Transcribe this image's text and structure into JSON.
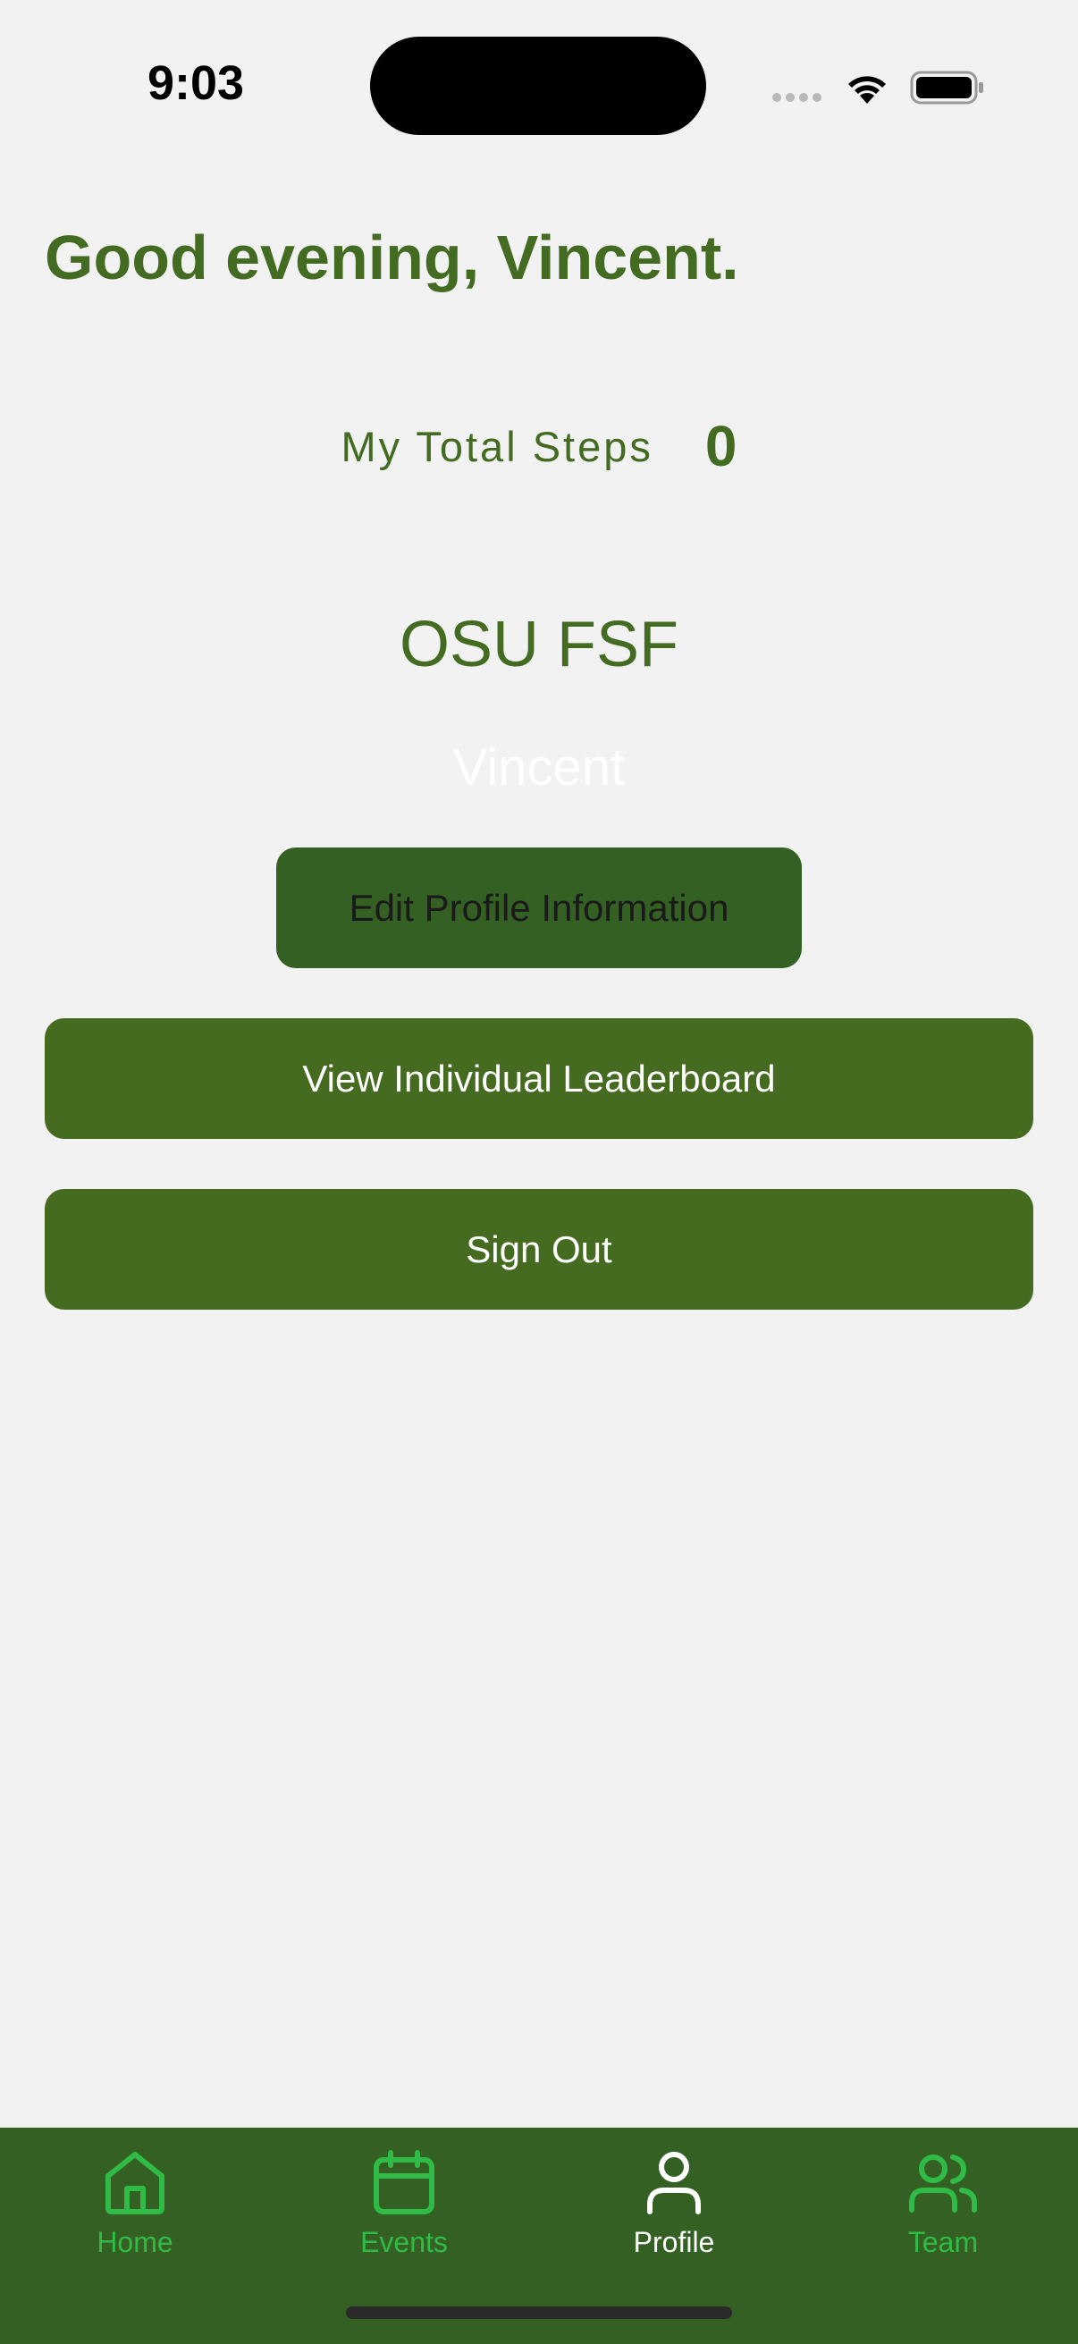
{
  "status_bar": {
    "time": "9:03"
  },
  "header": {
    "greeting": "Good evening, Vincent."
  },
  "steps": {
    "label": "My Total Steps",
    "value": "0"
  },
  "profile": {
    "team_name": "OSU FSF",
    "user_name": "Vincent"
  },
  "actions": {
    "edit_label": "Edit Profile Information",
    "leaderboard_label": "View Individual Leaderboard",
    "signout_label": "Sign Out"
  },
  "tabs": [
    {
      "label": "Home",
      "icon": "home-icon",
      "active": false
    },
    {
      "label": "Events",
      "icon": "calendar-icon",
      "active": false
    },
    {
      "label": "Profile",
      "icon": "person-icon",
      "active": true
    },
    {
      "label": "Team",
      "icon": "team-icon",
      "active": false
    }
  ],
  "colors": {
    "accent_green": "#436b21",
    "tab_bar": "#356024",
    "tab_inactive": "#2fbb46",
    "tab_active": "#ffffff",
    "background": "#f2f2f2"
  }
}
